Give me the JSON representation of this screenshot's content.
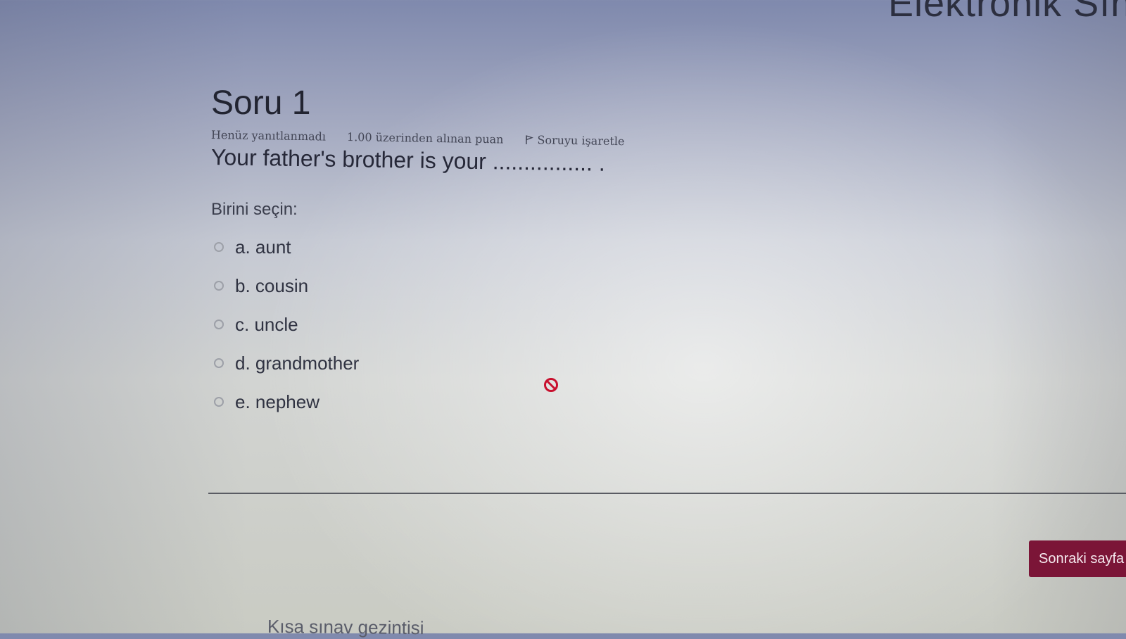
{
  "header": {
    "title_partial": "Elektronik Sın"
  },
  "question": {
    "title": "Soru 1",
    "status": "Henüz yanıtlanmadı",
    "grade": "1.00 üzerinden alınan puan",
    "flag_label": "Soruyu işaretle",
    "text": "Your father's brother is your ................ .",
    "prompt": "Birini seçin:",
    "options": [
      {
        "label": "a. aunt"
      },
      {
        "label": "b. cousin"
      },
      {
        "label": "c. uncle"
      },
      {
        "label": "d. grandmother"
      },
      {
        "label": "e. nephew"
      }
    ]
  },
  "footer": {
    "next_label": "Sonraki sayfa",
    "nav_heading": "Kısa sınav gezintisi"
  },
  "colors": {
    "next_button": "#7b1537",
    "block_icon": "#c8102e"
  },
  "icons": {
    "flag": "flag-icon",
    "cursor": "not-allowed-icon"
  }
}
